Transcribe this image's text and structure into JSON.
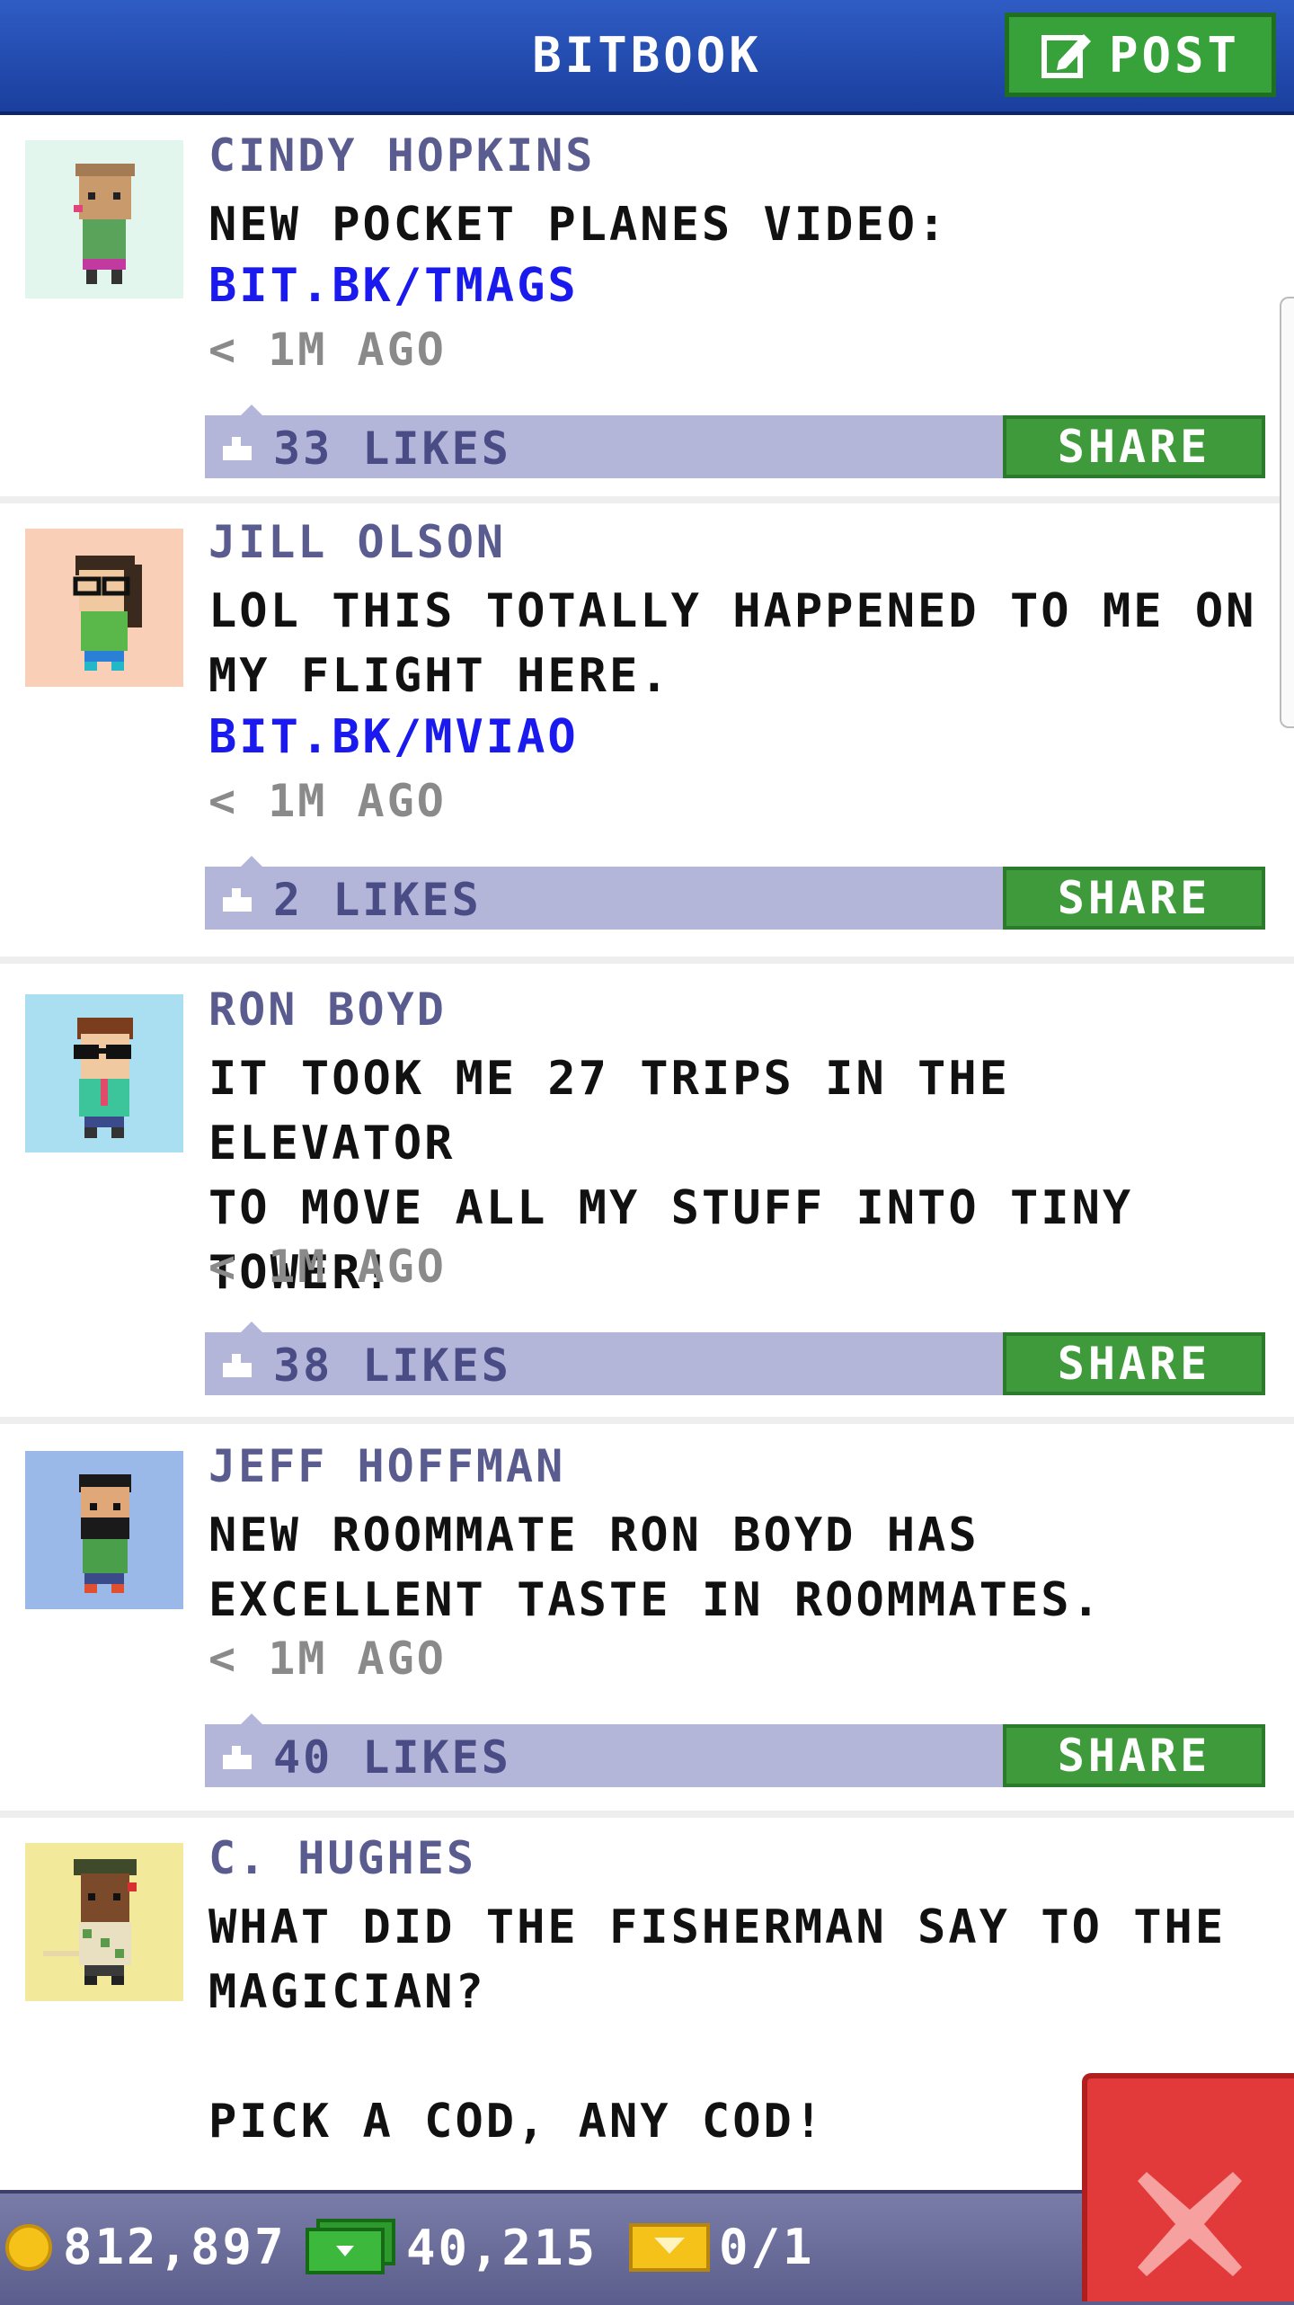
{
  "header": {
    "title": "BITBOOK",
    "post_label": "POST"
  },
  "posts": [
    {
      "name": "CINDY HOPKINS",
      "text": "NEW POCKET PLANES VIDEO:",
      "link": "BIT.BK/TMAGS",
      "time": "< 1M AGO",
      "likes": "33 LIKES",
      "share": "SHARE",
      "avatar_bg": "#e2f6ee"
    },
    {
      "name": "JILL OLSON",
      "text": "LOL THIS TOTALLY HAPPENED TO ME ON\nMY FLIGHT HERE.",
      "link": "BIT.BK/MVIAO",
      "time": "< 1M AGO",
      "likes": "2 LIKES",
      "share": "SHARE",
      "avatar_bg": "#f9cfb8"
    },
    {
      "name": "RON BOYD",
      "text": "IT TOOK ME 27 TRIPS IN THE ELEVATOR\nTO MOVE ALL MY STUFF INTO TINY\nTOWER!",
      "time": "< 1M AGO",
      "likes": "38 LIKES",
      "share": "SHARE",
      "avatar_bg": "#a9dff0"
    },
    {
      "name": "JEFF HOFFMAN",
      "text": "NEW ROOMMATE RON BOYD HAS\nEXCELLENT TASTE IN ROOMMATES.",
      "time": "< 1M AGO",
      "likes": "40 LIKES",
      "share": "SHARE",
      "avatar_bg": "#9ab9e8"
    },
    {
      "name": "C. HUGHES",
      "text": "WHAT DID THE FISHERMAN SAY TO THE\nMAGICIAN?\n\nPICK A COD, ANY COD!",
      "avatar_bg": "#f2ea9a"
    }
  ],
  "stats": {
    "coins": "812,897",
    "bux": "40,215",
    "tickets": "0/1"
  },
  "colors": {
    "header": "#2a55bd",
    "green": "#3f9a3b",
    "like_bar": "#b3b5d9",
    "close": "#e23a3a"
  }
}
